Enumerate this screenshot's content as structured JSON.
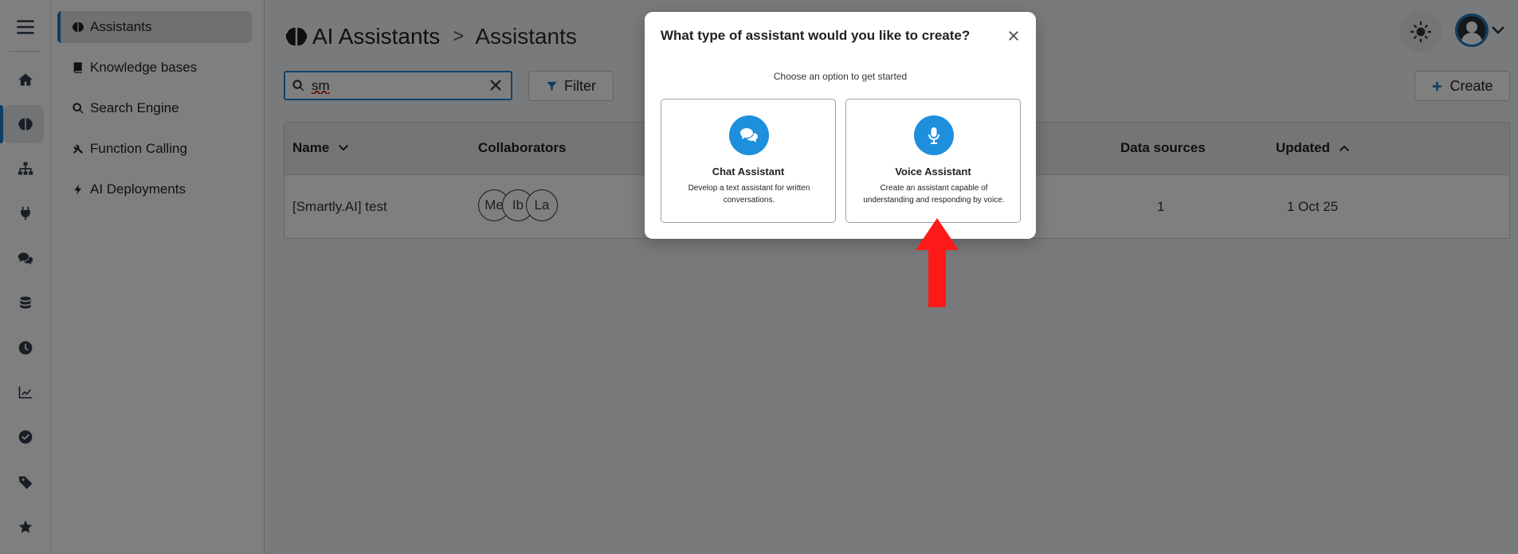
{
  "sidebar": {
    "items": [
      {
        "label": "Assistants",
        "icon": "brain-icon",
        "active": true
      },
      {
        "label": "Knowledge bases",
        "icon": "book-icon"
      },
      {
        "label": "Search Engine",
        "icon": "search-icon"
      },
      {
        "label": "Function Calling",
        "icon": "tools-icon"
      },
      {
        "label": "AI Deployments",
        "icon": "bolt-icon"
      }
    ]
  },
  "rail": {
    "icons": [
      "menu-icon",
      "home-icon",
      "brain-icon",
      "sitemap-icon",
      "plug-icon",
      "chat-icon",
      "database-icon",
      "clock-icon",
      "chart-line-icon",
      "check-circle-icon",
      "tag-icon",
      "star-icon"
    ]
  },
  "header": {
    "app": "AI Assistants",
    "separator": ">",
    "current": "Assistants"
  },
  "search": {
    "value": "sm"
  },
  "toolbar": {
    "filter_label": "Filter",
    "create_label": "Create"
  },
  "table": {
    "columns": {
      "name": "Name",
      "collaborators": "Collaborators",
      "data_sources": "Data sources",
      "updated": "Updated"
    },
    "rows": [
      {
        "name": "[Smartly.AI] test",
        "collaborators": [
          "Me",
          "Ib",
          "La"
        ],
        "data_sources": "1",
        "updated": "1 Oct 25"
      }
    ]
  },
  "modal": {
    "title": "What type of assistant would you like to create?",
    "subtitle": "Choose an option to get started",
    "options": [
      {
        "name": "Chat Assistant",
        "desc": "Develop a text assistant for written conversations.",
        "icon": "chat-bubbles-icon"
      },
      {
        "name": "Voice Assistant",
        "desc": "Create an assistant capable of understanding and responding by voice.",
        "icon": "microphone-icon"
      }
    ]
  },
  "colors": {
    "accent": "#1a7ac4",
    "option_icon_bg": "#1d8fdc",
    "annotation_arrow": "#ff1a1a"
  }
}
